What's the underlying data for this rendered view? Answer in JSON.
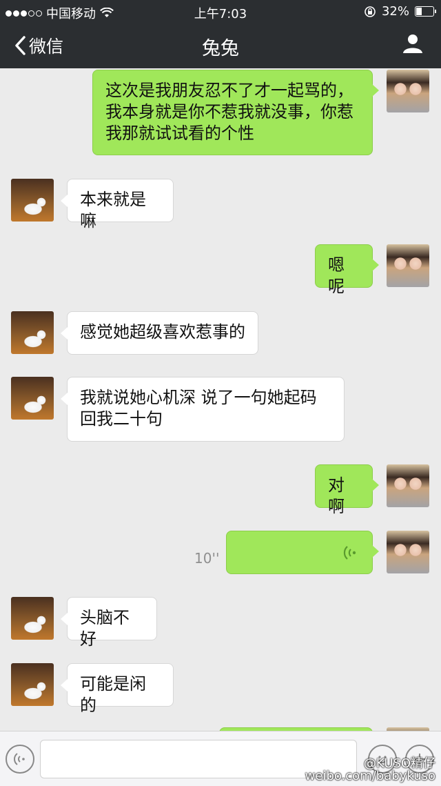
{
  "status": {
    "carrier": "中国移动",
    "time": "上午7:03",
    "battery": "32%"
  },
  "nav": {
    "back_label": "微信",
    "title": "兔兔"
  },
  "messages": [
    {
      "from": "me",
      "text": "这次是我朋友忍不了才一起骂的，我本身就是你不惹我就没事，你惹我那就试试看的个性"
    },
    {
      "from": "other",
      "text": "本来就是嘛"
    },
    {
      "from": "me",
      "text": "嗯呢"
    },
    {
      "from": "other",
      "text": "感觉她超级喜欢惹事的"
    },
    {
      "from": "other",
      "text": "我就说她心机深 说了一句她起码回我二十句"
    },
    {
      "from": "me",
      "text": "对啊"
    },
    {
      "from": "me",
      "type": "voice",
      "duration": "10''"
    },
    {
      "from": "other",
      "text": "头脑不好"
    },
    {
      "from": "other",
      "text": "可能是闲的"
    }
  ],
  "watermark": {
    "line1": "@KUSO精仔",
    "line2": "weibo.com/babykuso"
  },
  "icons": {
    "back": "chevron-left-icon",
    "profile": "person-icon",
    "voice_input": "voice-icon",
    "emoji": "emoji-icon",
    "more": "plus-icon"
  }
}
